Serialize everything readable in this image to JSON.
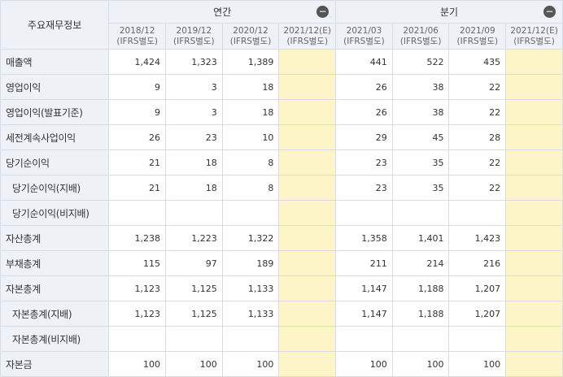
{
  "header": {
    "corner": "주요재무정보",
    "groups": [
      {
        "label": "연간",
        "collapse": "−"
      },
      {
        "label": "분기",
        "collapse": "−"
      }
    ],
    "periods": [
      {
        "date": "2018/12",
        "basis": "(IFRS별도)"
      },
      {
        "date": "2019/12",
        "basis": "(IFRS별도)"
      },
      {
        "date": "2020/12",
        "basis": "(IFRS별도)"
      },
      {
        "date": "2021/12(E)",
        "basis": "(IFRS별도)"
      },
      {
        "date": "2021/03",
        "basis": "(IFRS별도)"
      },
      {
        "date": "2021/06",
        "basis": "(IFRS별도)"
      },
      {
        "date": "2021/09",
        "basis": "(IFRS별도)"
      },
      {
        "date": "2021/12(E)",
        "basis": "(IFRS별도)"
      }
    ]
  },
  "rows": [
    {
      "label": "매출액",
      "values": [
        "1,424",
        "1,323",
        "1,389",
        "",
        "441",
        "522",
        "435",
        ""
      ]
    },
    {
      "label": "영업이익",
      "values": [
        "9",
        "3",
        "18",
        "",
        "26",
        "38",
        "22",
        ""
      ]
    },
    {
      "label": "영업이익(발표기준)",
      "values": [
        "9",
        "3",
        "18",
        "",
        "26",
        "38",
        "22",
        ""
      ]
    },
    {
      "label": "세전계속사업이익",
      "values": [
        "26",
        "23",
        "10",
        "",
        "29",
        "45",
        "28",
        ""
      ]
    },
    {
      "label": "당기순이익",
      "values": [
        "21",
        "18",
        "8",
        "",
        "23",
        "35",
        "22",
        ""
      ]
    },
    {
      "label": "당기순이익(지배)",
      "values": [
        "21",
        "18",
        "8",
        "",
        "23",
        "35",
        "22",
        ""
      ]
    },
    {
      "label": "당기순이익(비지배)",
      "values": [
        "",
        "",
        "",
        "",
        "",
        "",
        "",
        ""
      ]
    },
    {
      "label": "자산총계",
      "values": [
        "1,238",
        "1,223",
        "1,322",
        "",
        "1,358",
        "1,401",
        "1,423",
        ""
      ]
    },
    {
      "label": "부채총계",
      "values": [
        "115",
        "97",
        "189",
        "",
        "211",
        "214",
        "216",
        ""
      ]
    },
    {
      "label": "자본총계",
      "values": [
        "1,123",
        "1,125",
        "1,133",
        "",
        "1,147",
        "1,188",
        "1,207",
        ""
      ]
    },
    {
      "label": "자본총계(지배)",
      "values": [
        "1,123",
        "1,125",
        "1,133",
        "",
        "1,147",
        "1,188",
        "1,207",
        ""
      ]
    },
    {
      "label": "자본총계(비지배)",
      "values": [
        "",
        "",
        "",
        "",
        "",
        "",
        "",
        ""
      ]
    },
    {
      "label": "자본금",
      "values": [
        "100",
        "100",
        "100",
        "",
        "100",
        "100",
        "100",
        ""
      ]
    }
  ],
  "estimate_color": "#fdf4c8"
}
